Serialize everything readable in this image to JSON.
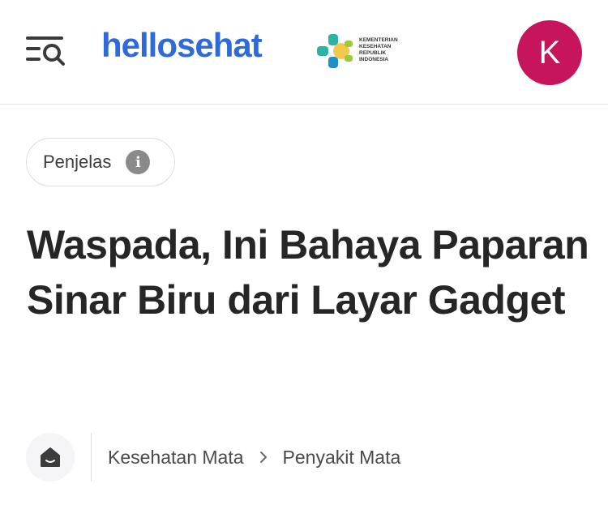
{
  "header": {
    "menu_icon": "menu-search-icon",
    "logo_text": "hellosehat",
    "partner_logo": {
      "lines": [
        "KEMENTERIAN",
        "KESEHATAN",
        "REPUBLIK",
        "INDONESIA"
      ]
    },
    "avatar_initial": "K"
  },
  "article": {
    "category_chip": "Penjelas",
    "info_icon": "info-icon",
    "title": "Waspada, Ini Bahaya Paparan Sinar Biru dari Layar Gadget"
  },
  "breadcrumb": {
    "home_icon": "home-icon",
    "items": [
      "Kesehatan Mata",
      "Penyakit Mata"
    ],
    "separator_icon": "chevron-right-icon"
  },
  "colors": {
    "brand_blue": "#2f6bd8",
    "avatar_bg": "#c6155a",
    "title": "#262626",
    "text_muted": "#4a4a4a"
  }
}
